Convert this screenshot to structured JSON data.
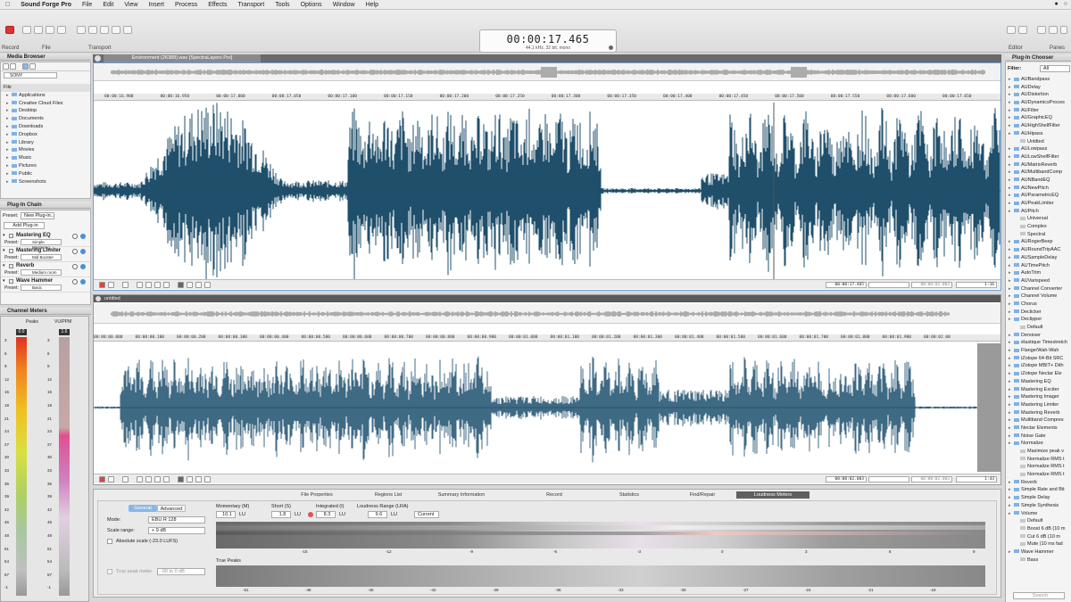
{
  "menubar": {
    "app": "Sound Forge Pro",
    "items": [
      "File",
      "Edit",
      "View",
      "Insert",
      "Process",
      "Effects",
      "Transport",
      "Tools",
      "Options",
      "Window",
      "Help"
    ]
  },
  "toolbar": {
    "groups": [
      "Record",
      "File",
      "Transport"
    ],
    "right_groups": [
      "Editor",
      "Panes"
    ],
    "time": "00:00:17.465",
    "format": "44.1 kHz, 32 bit, mono"
  },
  "doc_title": "Environment (26388).wav [SpectraLayers Pro]",
  "media_browser": {
    "title": "Media Browser",
    "source": "SONY",
    "section": "File",
    "items": [
      "Applications",
      "Creative Cloud Files",
      "Desktop",
      "Documents",
      "Downloads",
      "Dropbox",
      "Library",
      "Movies",
      "Music",
      "Pictures",
      "Public",
      "Screenshots"
    ]
  },
  "plugin_chain": {
    "title": "Plug-In Chain",
    "preset_label": "Preset:",
    "preset_value": "New Plug-in...",
    "add_label": "Add Plug-in",
    "plugins": [
      {
        "name": "Mastering EQ",
        "preset": "Simple Mastering"
      },
      {
        "name": "Mastering Limiter",
        "preset": "Mid Booster"
      },
      {
        "name": "Reverb",
        "preset": "Medium room"
      },
      {
        "name": "Wave Hammer",
        "preset": "Basic"
      }
    ]
  },
  "channel_meters": {
    "title": "Channel Meters",
    "left_label": "Peaks",
    "right_label": "VU/PPM",
    "left_value": "0.0",
    "right_value": "1.6",
    "scale": [
      "3",
      "6",
      "9",
      "12",
      "15",
      "18",
      "21",
      "24",
      "27",
      "30",
      "33",
      "36",
      "39",
      "42",
      "45",
      "48",
      "51",
      "54",
      "57",
      "-1"
    ]
  },
  "wave1": {
    "tab": "Environment (26388).wav [SpectraLayers Pro]",
    "ruler": [
      "00:00:16.900",
      "00:00:16.950",
      "00:00:17.000",
      "00:00:17.050",
      "00:00:17.100",
      "00:00:17.150",
      "00:00:17.200",
      "00:00:17.250",
      "00:00:17.300",
      "00:00:17.350",
      "00:00:17.400",
      "00:00:17.450",
      "00:00:17.500",
      "00:00:17.550",
      "00:00:17.600",
      "00:00:17.650"
    ],
    "status_time": "00:00:17.465",
    "status_len": "00:00:02.003",
    "zoom": "1:16"
  },
  "wave2": {
    "tab": "untitled",
    "ruler": [
      "00:00:00.000",
      "00:00:00.100",
      "00:00:00.200",
      "00:00:00.300",
      "00:00:00.400",
      "00:00:00.500",
      "00:00:00.600",
      "00:00:00.700",
      "00:00:00.800",
      "00:00:00.900",
      "00:00:01.000",
      "00:00:01.100",
      "00:00:01.200",
      "00:00:01.300",
      "00:00:01.400",
      "00:00:01.500",
      "00:00:01.600",
      "00:00:01.700",
      "00:00:01.800",
      "00:00:01.900",
      "00:00:02.00"
    ],
    "status_time": "00:00:02.003",
    "status_len": "00:00:02.003",
    "zoom": "1:43"
  },
  "bottom": {
    "tabs": [
      "File Properties",
      "Regions List",
      "Summary Information",
      "Record",
      "Statistics",
      "Find/Repair",
      "Loudness Meters"
    ],
    "subtabs": [
      "General",
      "Advanced"
    ],
    "mode_label": "Mode:",
    "mode_value": "EBU R 128",
    "scale_label": "Scale range:",
    "scale_value": "+ 9 dB",
    "absolute_label": "Absolute scale (-23.0 LUFS)",
    "truepeak_label": "True peak meter",
    "truepeak_value": "-90 to 0 dB",
    "momentary_label": "Momentary (M)",
    "momentary_value": "10.1",
    "short_label": "Short (S)",
    "short_value": "1.8",
    "integrated_label": "Integrated (I)",
    "integrated_value": "8.3",
    "range_label": "Loudness Range (LRA)",
    "range_value": "9.6",
    "unit": "LU",
    "current": "Current",
    "true_peaks_label": "True Peaks",
    "lu_scale": [
      "-15",
      "-12",
      "-9",
      "-6",
      "-3",
      "0",
      "3",
      "6",
      "9"
    ],
    "tp_scale": [
      "-51",
      "-48",
      "-45",
      "-42",
      "-39",
      "-36",
      "-33",
      "-30",
      "-27",
      "-24",
      "-21",
      "-18"
    ]
  },
  "plugin_chooser": {
    "title": "Plug-In Chooser",
    "filter_label": "Filter:",
    "filter_value": "All",
    "search_placeholder": "Search",
    "items": [
      [
        "AUBandpass",
        0
      ],
      [
        "AUDelay",
        0
      ],
      [
        "AUDistortion",
        0
      ],
      [
        "AUDynamicsProces",
        0
      ],
      [
        "AUFilter",
        0
      ],
      [
        "AUGraphicEQ",
        0
      ],
      [
        "AUHighShelfFilter",
        0
      ],
      [
        "AUHipass",
        0
      ],
      [
        "Untitled",
        1
      ],
      [
        "AULowpass",
        0
      ],
      [
        "AULowShelfFilter",
        0
      ],
      [
        "AUMatrixReverb",
        0
      ],
      [
        "AUMultibandComp",
        0
      ],
      [
        "AUNBandEQ",
        0
      ],
      [
        "AUNewPitch",
        0
      ],
      [
        "AUParametricEQ",
        0
      ],
      [
        "AUPeakLimiter",
        0
      ],
      [
        "AUPitch",
        0
      ],
      [
        "Universal",
        1
      ],
      [
        "Complex",
        1
      ],
      [
        "Spectral",
        1
      ],
      [
        "AURogerBeep",
        0
      ],
      [
        "AURoundTripAAC",
        0
      ],
      [
        "AUSampleDelay",
        0
      ],
      [
        "AUTimePitch",
        0
      ],
      [
        "AutoTrim",
        0
      ],
      [
        "AUVarispeed",
        0
      ],
      [
        "Channel Converter",
        0
      ],
      [
        "Channel Volume",
        0
      ],
      [
        "Chorus",
        0
      ],
      [
        "Declicker",
        0
      ],
      [
        "Declipper",
        0
      ],
      [
        "Default",
        1
      ],
      [
        "Denoiser",
        0
      ],
      [
        "élastique Timestretch",
        0
      ],
      [
        "Flange/Wah-Wah",
        0
      ],
      [
        "iZotope 64-Bit SRC",
        0
      ],
      [
        "iZotope MBIT+ Dith",
        0
      ],
      [
        "iZotope Nectar Ele",
        0
      ],
      [
        "Mastering EQ",
        0
      ],
      [
        "Mastering Exciter",
        0
      ],
      [
        "Mastering Imager",
        0
      ],
      [
        "Mastering Limiter",
        0
      ],
      [
        "Mastering Reverb",
        0
      ],
      [
        "Multiband Compres",
        0
      ],
      [
        "Nectar Elements",
        0
      ],
      [
        "Noise Gate",
        0
      ],
      [
        "Normalize",
        0
      ],
      [
        "Maximize peak v",
        1
      ],
      [
        "Normalize RMS t",
        1
      ],
      [
        "Normalize RMS t",
        1
      ],
      [
        "Normalize RMS t",
        1
      ],
      [
        "Reverb",
        0
      ],
      [
        "Simple Rate and Bit",
        0
      ],
      [
        "Simple Delay",
        0
      ],
      [
        "Simple Synthesis",
        0
      ],
      [
        "Volume",
        0
      ],
      [
        "Default",
        1
      ],
      [
        "Boost 6 dB (10 m",
        1
      ],
      [
        "Cut 6 dB (10 m",
        1
      ],
      [
        "Mute (10 ms fad",
        1
      ],
      [
        "Wave Hammer",
        0
      ],
      [
        "Bass",
        1
      ]
    ]
  }
}
